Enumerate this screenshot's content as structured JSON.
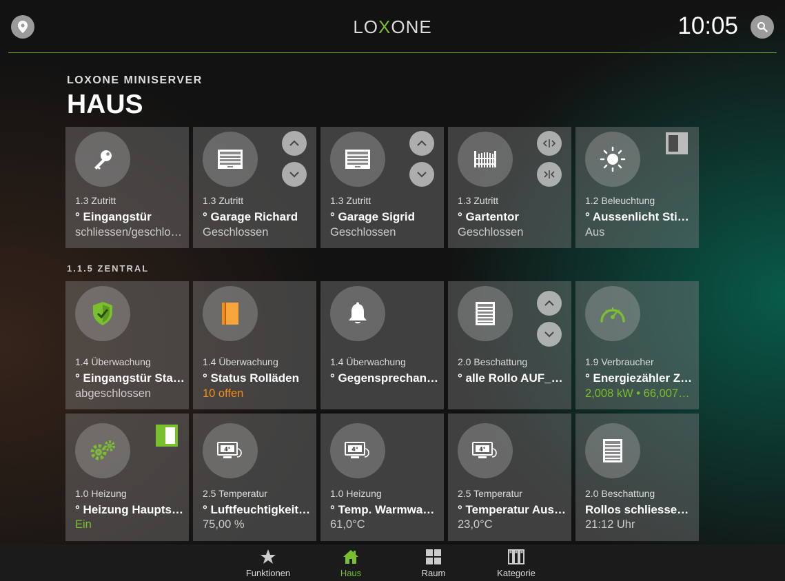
{
  "header": {
    "logo_left": "LO",
    "logo_x": "X",
    "logo_right": "ONE",
    "time": "10:05",
    "accent_color": "#7abf2d"
  },
  "page": {
    "subtitle": "LOXONE MINISERVER",
    "title": "HAUS"
  },
  "section": {
    "label": "1.1.5 ZENTRAL"
  },
  "tiles": [
    {
      "category": "1.3 Zutritt",
      "name": "° Eingangstür",
      "state": "schliessen/geschlo…",
      "icon": "key-icon"
    },
    {
      "category": "1.3 Zutritt",
      "name": "° Garage Richard",
      "state": "Geschlossen",
      "icon": "garage-door-icon"
    },
    {
      "category": "1.3 Zutritt",
      "name": "° Garage Sigrid",
      "state": "Geschlossen",
      "icon": "garage-door-icon"
    },
    {
      "category": "1.3 Zutritt",
      "name": "° Gartentor",
      "state": "Geschlossen",
      "icon": "gate-icon"
    },
    {
      "category": "1.2 Beleuchtung",
      "name": "° Aussenlicht Stiege",
      "state": "Aus",
      "icon": "sun-icon"
    },
    {
      "category": "1.4 Überwachung",
      "name": "° Eingangstür Status",
      "state": "abgeschlossen",
      "icon": "shield-icon"
    },
    {
      "category": "1.4 Überwachung",
      "name": "° Status Rolläden",
      "state": "10 offen",
      "icon": "door-icon"
    },
    {
      "category": "1.4 Überwachung",
      "name": "° Gegensprechanla…",
      "state": "",
      "icon": "bell-icon"
    },
    {
      "category": "2.0 Beschattung",
      "name": "° alle Rollo AUF_AB",
      "state": "",
      "icon": "blind-icon"
    },
    {
      "category": "1.9 Verbraucher",
      "name": "° Energiezähler Zen…",
      "state": "2,008 kW • 66,007…",
      "icon": "gauge-icon"
    },
    {
      "category": "1.0 Heizung",
      "name": "° Heizung Hauptsc…",
      "state": "Ein",
      "icon": "gears-icon"
    },
    {
      "category": "2.5 Temperatur",
      "name": "° Luftfeuchtigkeit a…",
      "state": "75,00 %",
      "icon": "thermostat-icon",
      "thermo_text": "4°"
    },
    {
      "category": "1.0 Heizung",
      "name": "° Temp. Warmwass…",
      "state": "61,0°C",
      "icon": "thermostat-icon",
      "thermo_text": "4°"
    },
    {
      "category": "2.5 Temperatur",
      "name": "° Temperatur Auss…",
      "state": "23,0°C",
      "icon": "thermostat-icon",
      "thermo_text": "4°"
    },
    {
      "category": "2.0 Beschattung",
      "name": "Rollos schliessen a…",
      "state": "21:12 Uhr",
      "icon": "blind-icon"
    }
  ],
  "nav": [
    {
      "label": "Funktionen",
      "icon": "star-icon"
    },
    {
      "label": "Haus",
      "icon": "home-icon"
    },
    {
      "label": "Raum",
      "icon": "grid-icon"
    },
    {
      "label": "Kategorie",
      "icon": "category-icon"
    }
  ],
  "colors": {
    "green": "#7abf2d",
    "orange": "#f0901a"
  }
}
